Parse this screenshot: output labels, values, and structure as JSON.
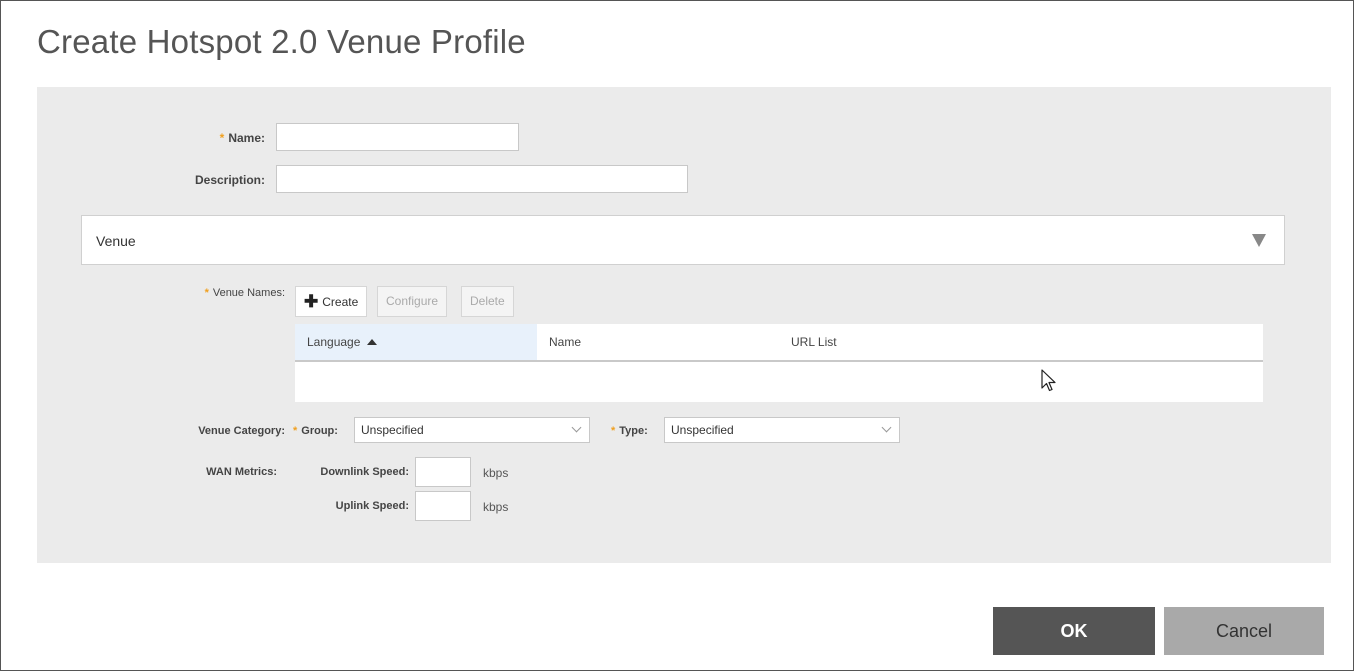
{
  "dialog": {
    "title": "Create Hotspot 2.0 Venue Profile"
  },
  "form": {
    "required_mark": "*",
    "name_label": "Name:",
    "name_value": "",
    "description_label": "Description:",
    "description_value": ""
  },
  "venue_section": {
    "title": "Venue",
    "venue_names_label": "Venue Names:",
    "toolbar": {
      "create_label": "Create",
      "configure_label": "Configure",
      "delete_label": "Delete"
    },
    "table": {
      "columns": [
        "Language",
        "Name",
        "URL List"
      ],
      "sorted_column": "Language",
      "sort_direction": "ascending",
      "rows": []
    },
    "venue_category_label": "Venue Category:",
    "group_label": "Group:",
    "group_value": "Unspecified",
    "type_label": "Type:",
    "type_value": "Unspecified",
    "wan_metrics_label": "WAN Metrics:",
    "downlink_label": "Downlink Speed:",
    "downlink_value": "",
    "uplink_label": "Uplink Speed:",
    "uplink_value": "",
    "unit": "kbps"
  },
  "footer": {
    "ok_label": "OK",
    "cancel_label": "Cancel"
  },
  "colors": {
    "required": "#f0a020",
    "panel_bg": "#ebebeb",
    "ok_bg": "#555555",
    "cancel_bg": "#a9a9a9",
    "sorted_header_bg": "#e8f1fb"
  }
}
